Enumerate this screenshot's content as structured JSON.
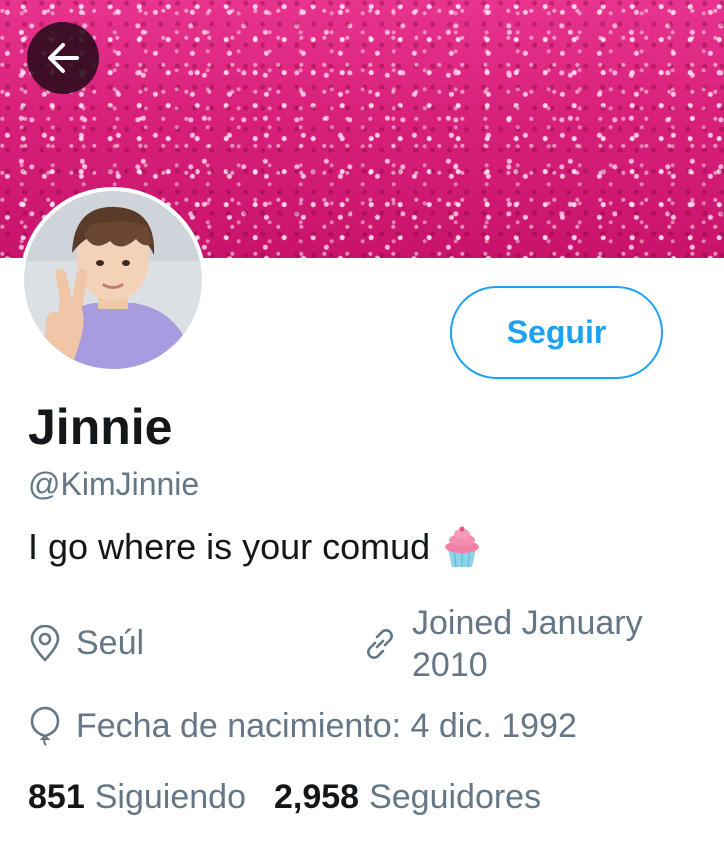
{
  "profile": {
    "display_name": "Jinnie",
    "handle": "@KimJinnie",
    "bio": "I go where is your comud",
    "bio_emoji": "cupcake-icon",
    "location": "Seúl",
    "joined": "Joined January 2010",
    "birthdate": "Fecha de nacimiento: 4 dic. 1992"
  },
  "actions": {
    "follow_label": "Seguir",
    "back_icon": "arrow-left-icon"
  },
  "stats": {
    "following_count": "851",
    "following_label": "Siguiendo",
    "followers_count": "2,958",
    "followers_label": "Seguidores"
  },
  "colors": {
    "accent": "#1da1f2",
    "secondary_text": "#657786",
    "banner": "#d8207a"
  }
}
